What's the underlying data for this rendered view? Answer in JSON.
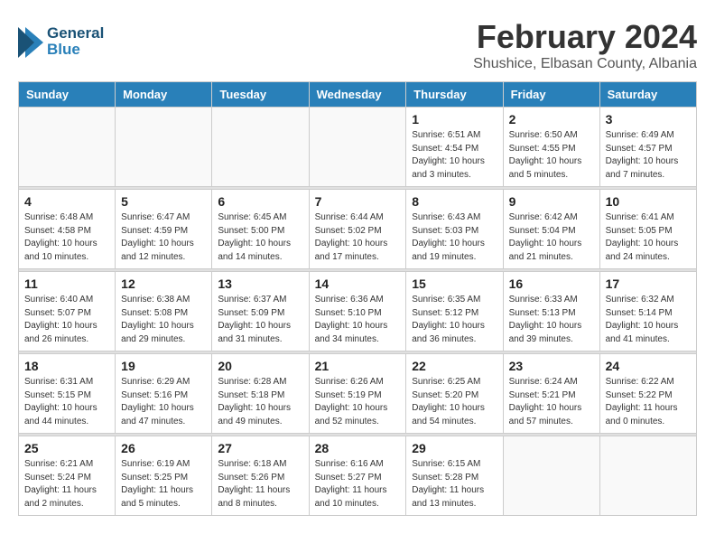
{
  "header": {
    "logo_general": "General",
    "logo_blue": "Blue",
    "month_title": "February 2024",
    "subtitle": "Shushice, Elbasan County, Albania"
  },
  "calendar": {
    "headers": [
      "Sunday",
      "Monday",
      "Tuesday",
      "Wednesday",
      "Thursday",
      "Friday",
      "Saturday"
    ],
    "weeks": [
      [
        {
          "day": "",
          "info": ""
        },
        {
          "day": "",
          "info": ""
        },
        {
          "day": "",
          "info": ""
        },
        {
          "day": "",
          "info": ""
        },
        {
          "day": "1",
          "info": "Sunrise: 6:51 AM\nSunset: 4:54 PM\nDaylight: 10 hours\nand 3 minutes."
        },
        {
          "day": "2",
          "info": "Sunrise: 6:50 AM\nSunset: 4:55 PM\nDaylight: 10 hours\nand 5 minutes."
        },
        {
          "day": "3",
          "info": "Sunrise: 6:49 AM\nSunset: 4:57 PM\nDaylight: 10 hours\nand 7 minutes."
        }
      ],
      [
        {
          "day": "4",
          "info": "Sunrise: 6:48 AM\nSunset: 4:58 PM\nDaylight: 10 hours\nand 10 minutes."
        },
        {
          "day": "5",
          "info": "Sunrise: 6:47 AM\nSunset: 4:59 PM\nDaylight: 10 hours\nand 12 minutes."
        },
        {
          "day": "6",
          "info": "Sunrise: 6:45 AM\nSunset: 5:00 PM\nDaylight: 10 hours\nand 14 minutes."
        },
        {
          "day": "7",
          "info": "Sunrise: 6:44 AM\nSunset: 5:02 PM\nDaylight: 10 hours\nand 17 minutes."
        },
        {
          "day": "8",
          "info": "Sunrise: 6:43 AM\nSunset: 5:03 PM\nDaylight: 10 hours\nand 19 minutes."
        },
        {
          "day": "9",
          "info": "Sunrise: 6:42 AM\nSunset: 5:04 PM\nDaylight: 10 hours\nand 21 minutes."
        },
        {
          "day": "10",
          "info": "Sunrise: 6:41 AM\nSunset: 5:05 PM\nDaylight: 10 hours\nand 24 minutes."
        }
      ],
      [
        {
          "day": "11",
          "info": "Sunrise: 6:40 AM\nSunset: 5:07 PM\nDaylight: 10 hours\nand 26 minutes."
        },
        {
          "day": "12",
          "info": "Sunrise: 6:38 AM\nSunset: 5:08 PM\nDaylight: 10 hours\nand 29 minutes."
        },
        {
          "day": "13",
          "info": "Sunrise: 6:37 AM\nSunset: 5:09 PM\nDaylight: 10 hours\nand 31 minutes."
        },
        {
          "day": "14",
          "info": "Sunrise: 6:36 AM\nSunset: 5:10 PM\nDaylight: 10 hours\nand 34 minutes."
        },
        {
          "day": "15",
          "info": "Sunrise: 6:35 AM\nSunset: 5:12 PM\nDaylight: 10 hours\nand 36 minutes."
        },
        {
          "day": "16",
          "info": "Sunrise: 6:33 AM\nSunset: 5:13 PM\nDaylight: 10 hours\nand 39 minutes."
        },
        {
          "day": "17",
          "info": "Sunrise: 6:32 AM\nSunset: 5:14 PM\nDaylight: 10 hours\nand 41 minutes."
        }
      ],
      [
        {
          "day": "18",
          "info": "Sunrise: 6:31 AM\nSunset: 5:15 PM\nDaylight: 10 hours\nand 44 minutes."
        },
        {
          "day": "19",
          "info": "Sunrise: 6:29 AM\nSunset: 5:16 PM\nDaylight: 10 hours\nand 47 minutes."
        },
        {
          "day": "20",
          "info": "Sunrise: 6:28 AM\nSunset: 5:18 PM\nDaylight: 10 hours\nand 49 minutes."
        },
        {
          "day": "21",
          "info": "Sunrise: 6:26 AM\nSunset: 5:19 PM\nDaylight: 10 hours\nand 52 minutes."
        },
        {
          "day": "22",
          "info": "Sunrise: 6:25 AM\nSunset: 5:20 PM\nDaylight: 10 hours\nand 54 minutes."
        },
        {
          "day": "23",
          "info": "Sunrise: 6:24 AM\nSunset: 5:21 PM\nDaylight: 10 hours\nand 57 minutes."
        },
        {
          "day": "24",
          "info": "Sunrise: 6:22 AM\nSunset: 5:22 PM\nDaylight: 11 hours\nand 0 minutes."
        }
      ],
      [
        {
          "day": "25",
          "info": "Sunrise: 6:21 AM\nSunset: 5:24 PM\nDaylight: 11 hours\nand 2 minutes."
        },
        {
          "day": "26",
          "info": "Sunrise: 6:19 AM\nSunset: 5:25 PM\nDaylight: 11 hours\nand 5 minutes."
        },
        {
          "day": "27",
          "info": "Sunrise: 6:18 AM\nSunset: 5:26 PM\nDaylight: 11 hours\nand 8 minutes."
        },
        {
          "day": "28",
          "info": "Sunrise: 6:16 AM\nSunset: 5:27 PM\nDaylight: 11 hours\nand 10 minutes."
        },
        {
          "day": "29",
          "info": "Sunrise: 6:15 AM\nSunset: 5:28 PM\nDaylight: 11 hours\nand 13 minutes."
        },
        {
          "day": "",
          "info": ""
        },
        {
          "day": "",
          "info": ""
        }
      ]
    ]
  }
}
